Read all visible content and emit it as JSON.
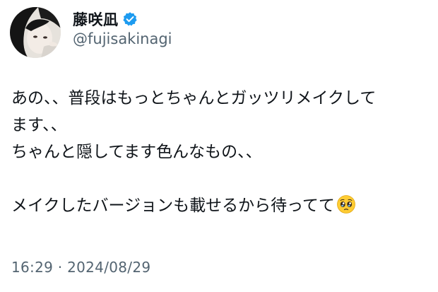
{
  "author": {
    "display_name": "藤咲凪",
    "handle": "@fujisakinagi",
    "verified": true,
    "avatar_icon": "profile-photo-avatar",
    "verified_icon": "verified-badge-icon"
  },
  "tweet": {
    "lines": [
      "あの、、普段はもっとちゃんとガッツリメイクして",
      "ます、、",
      "ちゃんと隠してます色んなもの、、",
      "",
      "メイクしたバージョンも載せるから待ってて"
    ],
    "trailing_emoji": "pleading-face-emoji"
  },
  "meta": {
    "timestamp": "16:29 · 2024/08/29"
  },
  "colors": {
    "text_primary": "#0f1419",
    "text_secondary": "#536471",
    "verified_blue": "#1d9bf0",
    "background": "#ffffff"
  }
}
